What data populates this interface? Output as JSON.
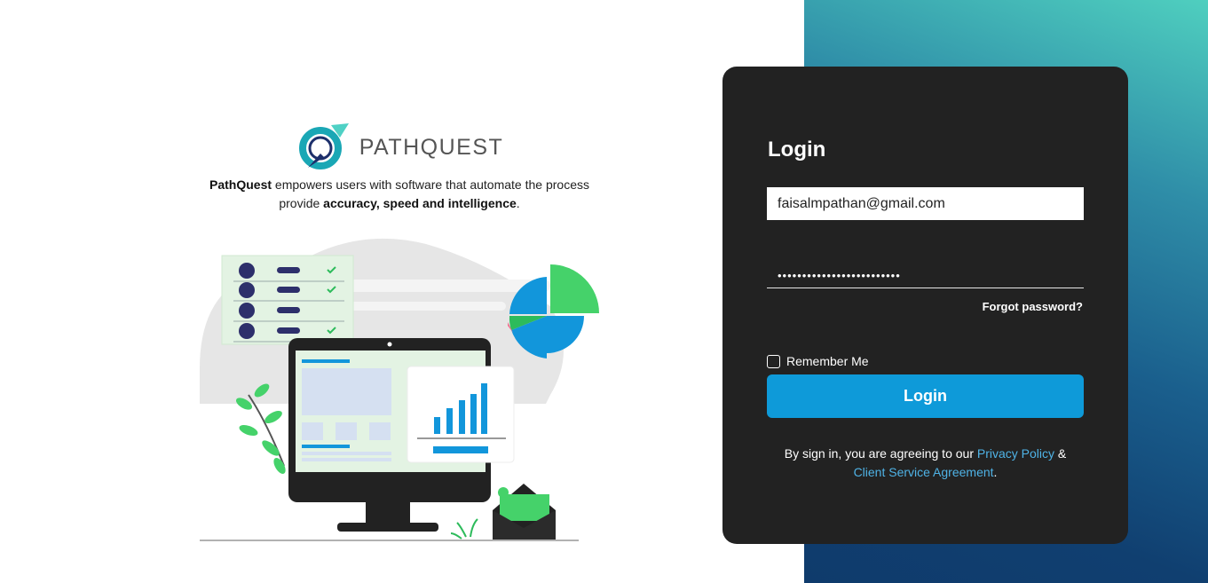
{
  "brand": {
    "logo_text": "PATHQUEST",
    "tagline": {
      "name": "PathQuest",
      "part1": " empowers users with software that automate the process provide ",
      "highlight": "accuracy, speed and intelligence",
      "part2": "."
    }
  },
  "login": {
    "title": "Login",
    "email_value": "faisalmpathan@gmail.com",
    "password_mask": "•••••••••••••••••••••••••",
    "forgot_label": "Forgot password?",
    "remember_label": "Remember Me",
    "remember_checked": false,
    "submit_label": "Login"
  },
  "terms": {
    "prefix": "By sign in, you are agreeing to our ",
    "privacy_label": "Privacy Policy",
    "amp": " &",
    "agreement_label": "Client Service Agreement",
    "suffix": "."
  },
  "colors": {
    "card_bg": "#222222",
    "accent": "#0e9ad9",
    "link": "#4fb3e6",
    "gradient_top": "#4fcfbf",
    "gradient_bottom": "#0f3b6c",
    "logo_teal": "#1aa7b5"
  }
}
